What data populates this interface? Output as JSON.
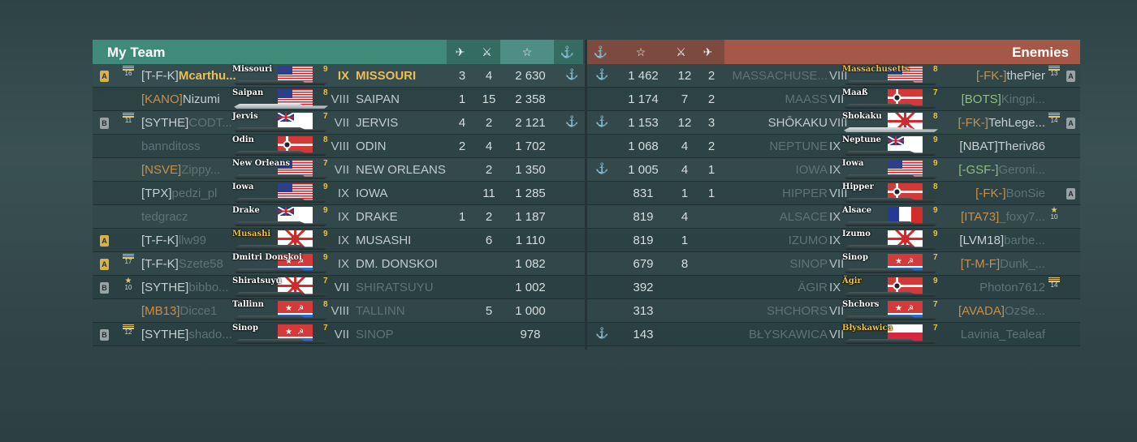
{
  "header": {
    "my_team": "My Team",
    "enemies": "Enemies",
    "icons_left": [
      "plane-icon",
      "kill-icon",
      "star-icon",
      "anchor-icon"
    ],
    "icons_right": [
      "anchor-icon",
      "star-icon",
      "kill-icon",
      "plane-icon"
    ]
  },
  "icon_glyphs": {
    "plane": "⛴",
    "kill": "✗",
    "star": "☆",
    "anchor": "⚓"
  },
  "my_team": [
    {
      "div": "A",
      "rank": "16",
      "clan": "[T-F-K]",
      "name": "Mcarthu...",
      "ship_label": "Missouri",
      "flag": "usa",
      "tier_small": "9",
      "tier": "IX",
      "ship": "MISSOURI",
      "planes": "3",
      "kills": "4",
      "xp": "2 630",
      "anchor": "⚓",
      "me": true
    },
    {
      "div": "",
      "rank": "",
      "clan": "[KANO]",
      "name": "Nizumi",
      "ship_label": "Saipan",
      "flag": "usa",
      "tier_small": "8",
      "tier": "VIII",
      "ship": "SAIPAN",
      "planes": "1",
      "kills": "15",
      "xp": "2 358",
      "anchor": "",
      "white": true
    },
    {
      "div": "B",
      "rank": "11",
      "clan": "[SYTHE]",
      "name": "CODT...",
      "ship_label": "Jervis",
      "flag": "uk",
      "tier_small": "7",
      "tier": "VII",
      "ship": "JERVIS",
      "planes": "4",
      "kills": "2",
      "xp": "2 121",
      "anchor": "⚓",
      "namedim": true
    },
    {
      "div": "",
      "rank": "",
      "clan": "",
      "name": "bannditoss",
      "ship_label": "Odin",
      "flag": "germany",
      "tier_small": "8",
      "tier": "VIII",
      "ship": "ODIN",
      "planes": "2",
      "kills": "4",
      "xp": "1 702",
      "anchor": "",
      "namedim": true
    },
    {
      "div": "",
      "rank": "",
      "clan": "[NSVE]",
      "name": "Zippy...",
      "ship_label": "New Orleans",
      "flag": "usa",
      "tier_small": "7",
      "tier": "VII",
      "ship": "NEW ORLEANS",
      "planes": "",
      "kills": "2",
      "xp": "1 350",
      "anchor": "",
      "namedim": true
    },
    {
      "div": "",
      "rank": "",
      "clan": "[TPX]",
      "name": "pedzi_pl",
      "ship_label": "Iowa",
      "flag": "usa",
      "tier_small": "9",
      "tier": "IX",
      "ship": "IOWA",
      "planes": "",
      "kills": "11",
      "xp": "1 285",
      "anchor": "",
      "namedim": true
    },
    {
      "div": "",
      "rank": "",
      "clan": "",
      "name": "tedgracz",
      "ship_label": "Drake",
      "flag": "uk",
      "tier_small": "9",
      "tier": "IX",
      "ship": "DRAKE",
      "planes": "1",
      "kills": "2",
      "xp": "1 187",
      "anchor": "",
      "namedim": true
    },
    {
      "div": "A",
      "rank": "",
      "clan": "[T-F-K]",
      "name": "llw99",
      "ship_label": "Musashi",
      "flag": "japan",
      "tier_small": "9",
      "tier": "IX",
      "ship": "MUSASHI",
      "planes": "",
      "kills": "6",
      "xp": "1 110",
      "anchor": "",
      "namedim": true,
      "gold": true
    },
    {
      "div": "A",
      "rank": "17",
      "clan": "[T-F-K]",
      "name": "Szete58",
      "ship_label": "Dmitri Donskoi",
      "flag": "ussr",
      "tier_small": "9",
      "tier": "IX",
      "ship": "DM. DONSKOI",
      "planes": "",
      "kills": "",
      "xp": "1 082",
      "anchor": "",
      "namedim": true
    },
    {
      "div": "B",
      "rank": "10",
      "clan": "[SYTHE]",
      "name": "bibbo...",
      "ship_label": "Shiratsuyu",
      "flag": "japan",
      "tier_small": "7",
      "tier": "VII",
      "ship": "SHIRATSUYU",
      "planes": "",
      "kills": "",
      "xp": "1 002",
      "anchor": "",
      "namedim": true,
      "shipdim": true
    },
    {
      "div": "",
      "rank": "",
      "clan": "[MB13]",
      "name": "Dicce1",
      "ship_label": "Tallinn",
      "flag": "ussr",
      "tier_small": "8",
      "tier": "VIII",
      "ship": "TALLINN",
      "planes": "",
      "kills": "5",
      "xp": "1 000",
      "anchor": "",
      "namedim": true,
      "shipdim": true
    },
    {
      "div": "B",
      "rank": "12",
      "clan": "[SYTHE]",
      "name": "shado...",
      "ship_label": "Sinop",
      "flag": "ussr",
      "tier_small": "7",
      "tier": "VII",
      "ship": "SINOP",
      "planes": "",
      "kills": "",
      "xp": "978",
      "anchor": "",
      "namedim": true,
      "shipdim": true
    }
  ],
  "enemy_team": [
    {
      "anchor": "⚓",
      "xp": "1 462",
      "kills": "12",
      "planes": "2",
      "ship": "MASSACHUSE...",
      "tier": "VIII",
      "ship_label": "Massachusetts",
      "flag": "usa",
      "tier_small": "8",
      "clan": "[-FK-]",
      "name": "thePier",
      "rank": "13",
      "div": "A",
      "gold": true,
      "shipdim": true
    },
    {
      "anchor": "",
      "xp": "1 174",
      "kills": "7",
      "planes": "2",
      "ship": "MAASS",
      "tier": "VII",
      "ship_label": "Maaß",
      "flag": "germany",
      "tier_small": "7",
      "clan": "[BOTS]",
      "name": "Kingpi...",
      "rank": "",
      "div": "",
      "shipdim": true,
      "namedim": true
    },
    {
      "anchor": "⚓",
      "xp": "1 153",
      "kills": "12",
      "planes": "3",
      "ship": "SHŌKAKU",
      "tier": "VIII",
      "ship_label": "Shokaku",
      "flag": "japan",
      "tier_small": "8",
      "clan": "[-FK-]",
      "name": "TehLege...",
      "rank": "14",
      "div": "A",
      "white": true
    },
    {
      "anchor": "",
      "xp": "1 068",
      "kills": "4",
      "planes": "2",
      "ship": "NEPTUNE",
      "tier": "IX",
      "ship_label": "Neptune",
      "flag": "uk",
      "tier_small": "9",
      "clan": "[NBAT]",
      "name": "Theriv86",
      "rank": "",
      "div": "",
      "shipdim": true
    },
    {
      "anchor": "⚓",
      "xp": "1 005",
      "kills": "4",
      "planes": "1",
      "ship": "IOWA",
      "tier": "IX",
      "ship_label": "Iowa",
      "flag": "usa",
      "tier_small": "9",
      "clan": "[-GSF-]",
      "name": "Geroni...",
      "rank": "",
      "div": "",
      "shipdim": true,
      "namedim": true
    },
    {
      "anchor": "",
      "xp": "831",
      "kills": "1",
      "planes": "1",
      "ship": "HIPPER",
      "tier": "VIII",
      "ship_label": "Hipper",
      "flag": "germany",
      "tier_small": "8",
      "clan": "[-FK-]",
      "name": "BonSie",
      "rank": "",
      "div": "A",
      "shipdim": true,
      "namedim": true
    },
    {
      "anchor": "",
      "xp": "819",
      "kills": "4",
      "planes": "",
      "ship": "ALSACE",
      "tier": "IX",
      "ship_label": "Alsace",
      "flag": "france",
      "tier_small": "9",
      "clan": "[ITA73]",
      "name": "_foxy7...",
      "rank": "10",
      "div": "",
      "shipdim": true,
      "namedim": true,
      "star": true
    },
    {
      "anchor": "",
      "xp": "819",
      "kills": "1",
      "planes": "",
      "ship": "IZUMO",
      "tier": "IX",
      "ship_label": "Izumo",
      "flag": "japan",
      "tier_small": "9",
      "clan": "[LVM18]",
      "name": "barbe...",
      "rank": "",
      "div": "",
      "shipdim": true,
      "namedim": true
    },
    {
      "anchor": "",
      "xp": "679",
      "kills": "8",
      "planes": "",
      "ship": "SINOP",
      "tier": "VII",
      "ship_label": "Sinop",
      "flag": "ussr",
      "tier_small": "7",
      "clan": "[T-M-F]",
      "name": "Dunk_...",
      "rank": "",
      "div": "",
      "shipdim": true,
      "namedim": true
    },
    {
      "anchor": "",
      "xp": "392",
      "kills": "",
      "planes": "",
      "ship": "ÄGIR",
      "tier": "IX",
      "ship_label": "Ägir",
      "flag": "germany",
      "tier_small": "9",
      "clan": "",
      "name": "Photon7612",
      "rank": "14",
      "div": "",
      "shipdim": true,
      "namedim": true,
      "gold": true
    },
    {
      "anchor": "",
      "xp": "313",
      "kills": "",
      "planes": "",
      "ship": "SHCHORS",
      "tier": "VII",
      "ship_label": "Shchors",
      "flag": "ussr",
      "tier_small": "7",
      "clan": "[AVADA]",
      "name": "OzSe...",
      "rank": "",
      "div": "",
      "shipdim": true,
      "namedim": true
    },
    {
      "anchor": "⚓",
      "xp": "143",
      "kills": "",
      "planes": "",
      "ship": "BŁYSKAWICA",
      "tier": "VII",
      "ship_label": "Błyskawica",
      "flag": "poland",
      "tier_small": "7",
      "clan": "",
      "name": "Lavinia_Tealeaf",
      "rank": "",
      "div": "",
      "shipdim": true,
      "namedim": true,
      "gold": true
    }
  ]
}
